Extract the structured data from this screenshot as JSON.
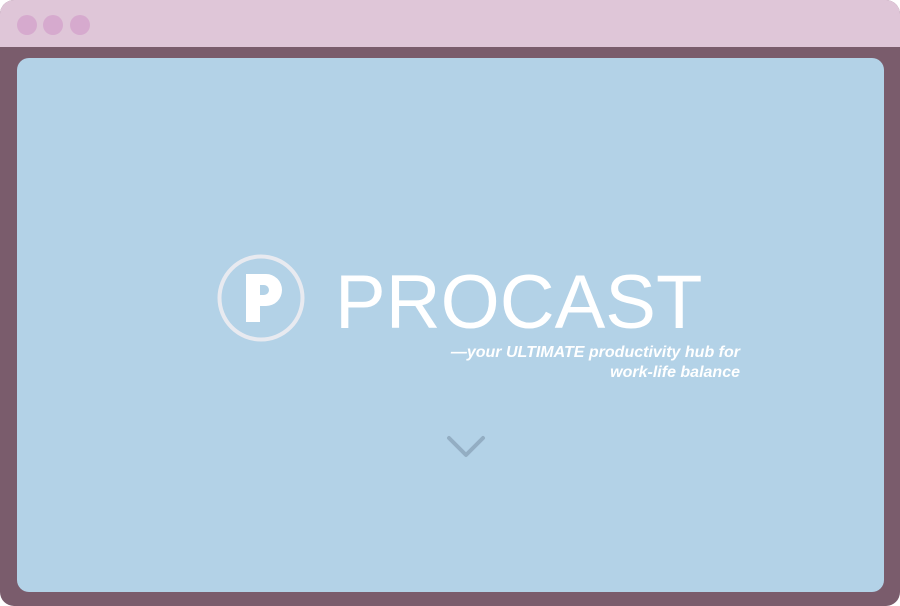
{
  "window": {
    "controls": [
      "close-dot",
      "minimize-dot",
      "maximize-dot"
    ]
  },
  "hero": {
    "logo_icon": "procast-p-logo-icon",
    "brand_name": "PROCAST",
    "tagline_line1": "—your ULTIMATE productivity hub for",
    "tagline_line2": "work-life balance",
    "scroll_icon": "chevron-down-icon"
  },
  "colors": {
    "frame": "#7a5c6c",
    "titlebar": "#dfc6d8",
    "window_dots": "#d6aace",
    "hero_background": "#b3d2e7",
    "text": "#ffffff",
    "logo_ring": "#e8eaf0",
    "chevron": "#93aec3"
  }
}
